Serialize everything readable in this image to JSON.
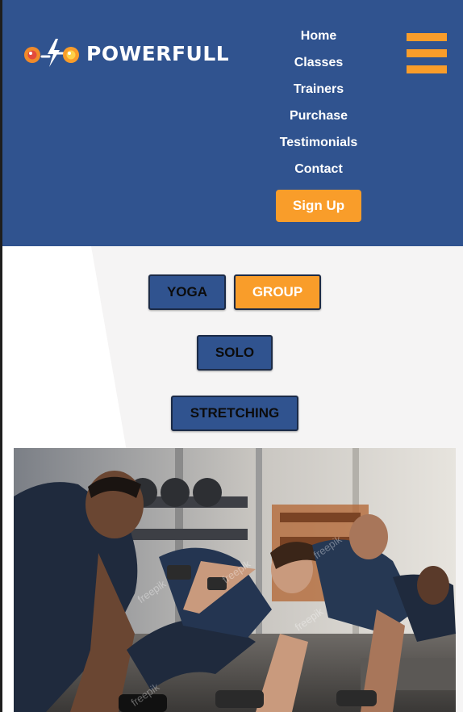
{
  "brand": {
    "name": "POWERFULL",
    "accent_color": "#f99d2a",
    "header_color": "#30538f"
  },
  "nav": {
    "items": [
      {
        "label": "Home"
      },
      {
        "label": "Classes"
      },
      {
        "label": "Trainers"
      },
      {
        "label": "Purchase"
      },
      {
        "label": "Testimonials"
      },
      {
        "label": "Contact"
      }
    ],
    "signup_label": "Sign Up",
    "menu_icon": "hamburger-icon"
  },
  "filters": [
    {
      "label": "YOGA",
      "active": false
    },
    {
      "label": "GROUP",
      "active": true
    },
    {
      "label": "SOLO",
      "active": false
    },
    {
      "label": "STRETCHING",
      "active": false
    }
  ],
  "photo": {
    "watermark": "freepik"
  }
}
